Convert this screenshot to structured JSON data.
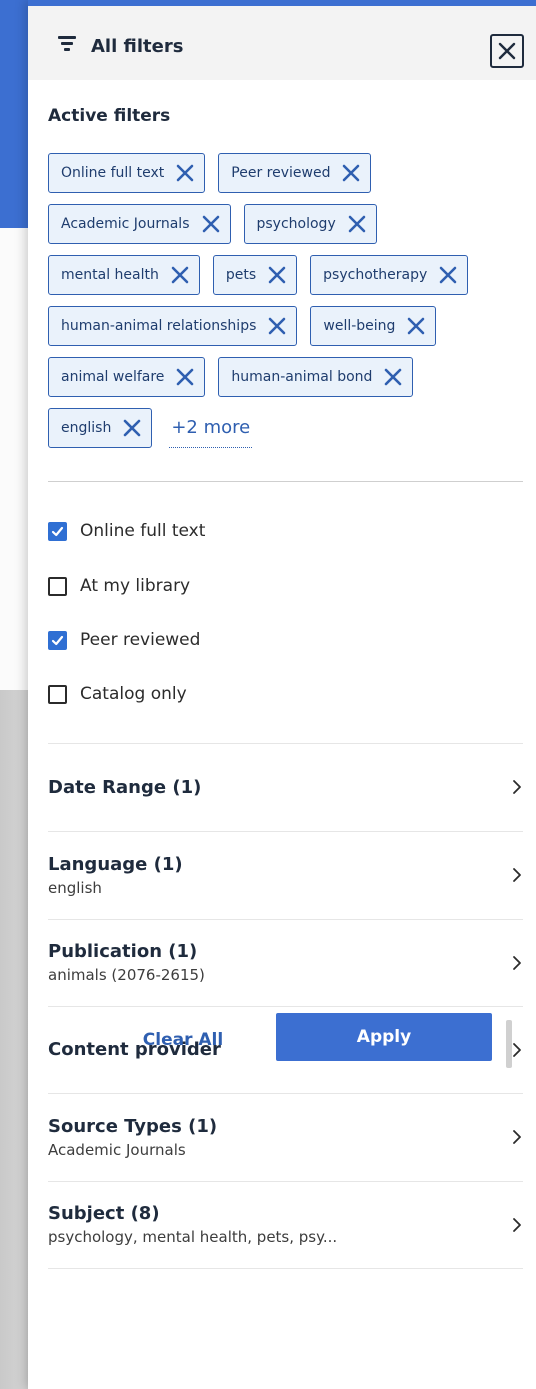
{
  "header": {
    "title": "All filters",
    "icon": "filter-icon",
    "close_icon": "close-icon"
  },
  "active_filters": {
    "title": "Active filters",
    "chips": [
      {
        "label": "Online full text"
      },
      {
        "label": "Peer reviewed"
      },
      {
        "label": "Academic Journals"
      },
      {
        "label": "psychology"
      },
      {
        "label": "mental health"
      },
      {
        "label": "pets"
      },
      {
        "label": "psychotherapy"
      },
      {
        "label": "human-animal relationships"
      },
      {
        "label": "well-being"
      },
      {
        "label": "animal welfare"
      },
      {
        "label": "human-animal bond"
      },
      {
        "label": "english"
      }
    ],
    "more_label": "+2 more"
  },
  "checkboxes": [
    {
      "label": "Online full text",
      "checked": true
    },
    {
      "label": "At my library",
      "checked": false
    },
    {
      "label": "Peer reviewed",
      "checked": true
    },
    {
      "label": "Catalog only",
      "checked": false
    }
  ],
  "sections": [
    {
      "title": "Date Range (1)",
      "subtitle": ""
    },
    {
      "title": "Language (1)",
      "subtitle": "english"
    },
    {
      "title": "Publication (1)",
      "subtitle": "animals (2076-2615)"
    },
    {
      "title": "Content provider",
      "subtitle": ""
    },
    {
      "title": "Source Types (1)",
      "subtitle": "Academic Journals"
    },
    {
      "title": "Subject (8)",
      "subtitle": "psychology, mental health, pets, psy..."
    }
  ],
  "footer": {
    "clear_label": "Clear All",
    "apply_label": "Apply"
  },
  "colors": {
    "accent": "#3c6fd1",
    "chip_bg": "#eaf2fb",
    "chip_border": "#2f5fb0",
    "checkbox_checked": "#2f6fd3",
    "text_dark": "#1f2b3d"
  }
}
